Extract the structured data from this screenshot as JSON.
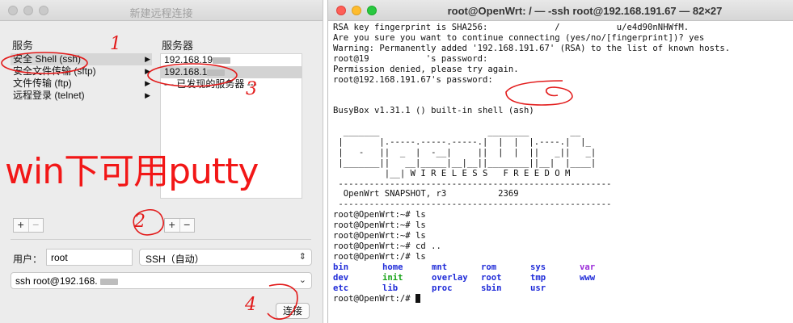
{
  "left_window": {
    "title": "新建远程连接",
    "services_header": "服务",
    "servers_header": "服务器",
    "services": [
      {
        "label": "安全 Shell (ssh)",
        "selected": true
      },
      {
        "label": "安全文件传输 (sftp)",
        "selected": false
      },
      {
        "label": "文件传输 (ftp)",
        "selected": false
      },
      {
        "label": "远程登录 (telnet)",
        "selected": false
      }
    ],
    "servers": [
      {
        "label": "192.168.19",
        "selected": false
      },
      {
        "label": "192.168.1",
        "selected": true
      },
      {
        "label": "--- 已发现的服务器 ---",
        "selected": false
      }
    ],
    "plus_label": "+",
    "minus_label": "−",
    "user_label": "用户：",
    "user_value": "root",
    "protocol_value": "SSH（自动）",
    "command_value": "ssh root@192.168.",
    "connect_label": "连接",
    "annotation_putty": "win下可用putty",
    "annotation_marks": [
      "1",
      "3",
      "2",
      "4"
    ]
  },
  "terminal": {
    "title": "root@OpenWrt: / — -ssh root@192.168.191.67 — 82×27",
    "lines": [
      "RSA key fingerprint is SHA256:             /           u/e4d90nNHWfM.",
      "Are you sure you want to continue connecting (yes/no/[fingerprint])? yes",
      "Warning: Permanently added '192.168.191.67' (RSA) to the list of known hosts.",
      "root@19           's password:",
      "Permission denied, please try again.",
      "root@192.168.191.67's password:",
      "",
      "",
      "BusyBox v1.31.1 () built-in shell (ash)",
      "",
      "  _______                     ________        __",
      " |       |.-----.-----.-----.|  |  |  |.----.|  |_",
      " |   -   ||  _  |  -__|     ||  |  |  ||   _||   _|",
      " |_______||   __|_____|__|__||________||__|  |____|",
      "          |__| W I R E L E S S   F R E E D O M",
      " -----------------------------------------------------",
      "  OpenWrt SNAPSHOT, r3          2369",
      " -----------------------------------------------------",
      "root@OpenWrt:~# ls",
      "root@OpenWrt:~# ls",
      "root@OpenWrt:~# ls",
      "root@OpenWrt:~# cd ..",
      "root@OpenWrt:/# ls"
    ],
    "ls_rows": [
      [
        {
          "t": "bin",
          "c": "dir"
        },
        {
          "t": "home",
          "c": "dir"
        },
        {
          "t": "mnt",
          "c": "dir"
        },
        {
          "t": "rom",
          "c": "dir"
        },
        {
          "t": "sys",
          "c": "dir"
        },
        {
          "t": "var",
          "c": "lnk"
        }
      ],
      [
        {
          "t": "dev",
          "c": "dir"
        },
        {
          "t": "init",
          "c": "exe"
        },
        {
          "t": "overlay",
          "c": "dir"
        },
        {
          "t": "root",
          "c": "dir"
        },
        {
          "t": "tmp",
          "c": "dir"
        },
        {
          "t": "www",
          "c": "dir"
        }
      ],
      [
        {
          "t": "etc",
          "c": "dir"
        },
        {
          "t": "lib",
          "c": "dir"
        },
        {
          "t": "proc",
          "c": "dir"
        },
        {
          "t": "sbin",
          "c": "dir"
        },
        {
          "t": "usr",
          "c": "dir"
        }
      ]
    ],
    "final_prompt": "root@OpenWrt:/# "
  }
}
